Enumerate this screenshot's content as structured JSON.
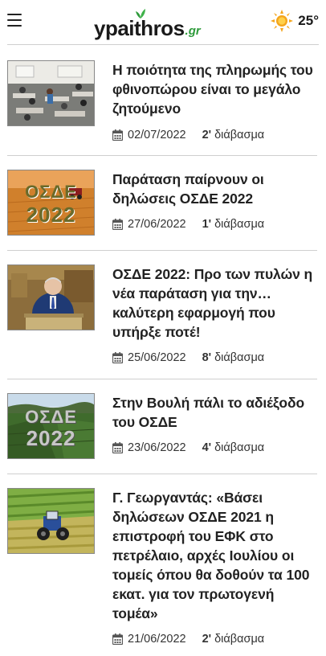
{
  "header": {
    "logo_main": "ypaithros",
    "logo_tld": ".gr",
    "temperature": "25°",
    "weather_icon": "sun-icon"
  },
  "articles": [
    {
      "title": "Η ποιότητα της πληρωμής του φθινοπώρου είναι το μεγάλο ζητούμενο",
      "date": "02/07/2022",
      "read_minutes": "2'",
      "read_label": "διάβασμα"
    },
    {
      "title": "Παράταση παίρνουν οι δηλώσεις ΟΣΔΕ 2022",
      "date": "27/06/2022",
      "read_minutes": "1'",
      "read_label": "διάβασμα",
      "thumb_text": [
        "ΟΣΔΕ",
        "2022"
      ]
    },
    {
      "title": "ΟΣΔΕ 2022: Προ των πυλών η νέα παράταση για την… καλύτερη εφαρμογή που υπήρξε ποτέ!",
      "date": "25/06/2022",
      "read_minutes": "8'",
      "read_label": "διάβασμα"
    },
    {
      "title": "Στην Βουλή πάλι το αδιέξοδο του ΟΣΔΕ",
      "date": "23/06/2022",
      "read_minutes": "4'",
      "read_label": "διάβασμα",
      "thumb_text": [
        "ΟΣΔΕ",
        "2022"
      ]
    },
    {
      "title": "Γ. Γεωργαντάς: «Βάσει δηλώσεων ΟΣΔΕ 2021 η επιστροφή του ΕΦΚ στο πετρέλαιο, αρχές Ιουλίου οι τομείς όπου θα δοθούν τα 100 εκατ. για τον πρωτογενή τομέα»",
      "date": "21/06/2022",
      "read_minutes": "2'",
      "read_label": "διάβασμα"
    }
  ],
  "colors": {
    "brand_green": "#2d9a3a",
    "sun": "#f4a51c",
    "text": "#222222",
    "divider": "#cfcfcf"
  }
}
